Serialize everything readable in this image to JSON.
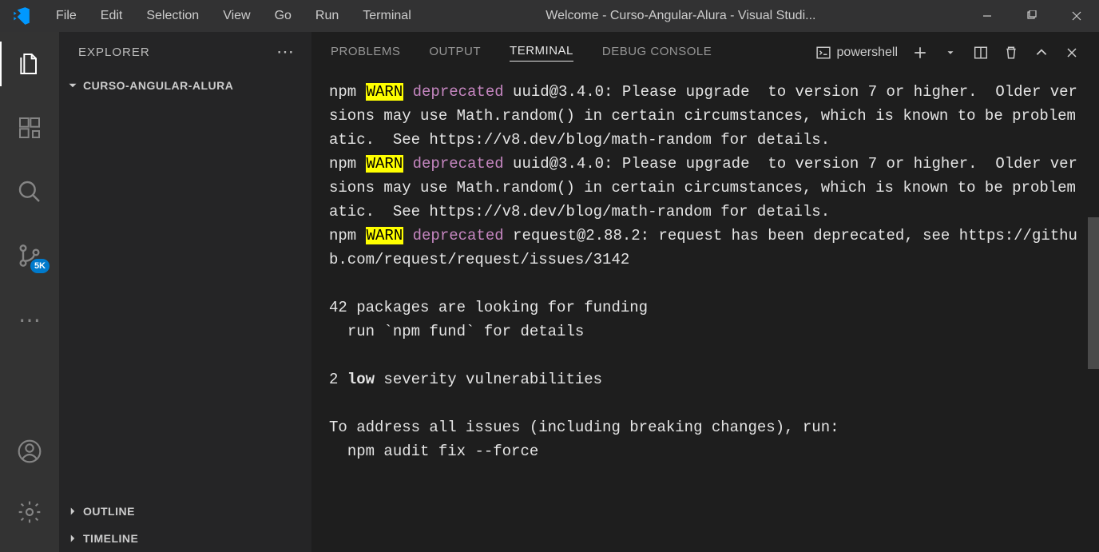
{
  "titlebar": {
    "menu": [
      "File",
      "Edit",
      "Selection",
      "View",
      "Go",
      "Run",
      "Terminal"
    ],
    "title": "Welcome - Curso-Angular-Alura - Visual Studi..."
  },
  "sidebar": {
    "header": "EXPLORER",
    "folder": "CURSO-ANGULAR-ALURA",
    "sections": [
      "OUTLINE",
      "TIMELINE"
    ]
  },
  "activitybar": {
    "badge": "5K"
  },
  "panel": {
    "tabs": [
      "PROBLEMS",
      "OUTPUT",
      "TERMINAL",
      "DEBUG CONSOLE"
    ],
    "active_tab": "TERMINAL",
    "shell": "powershell"
  },
  "terminal": {
    "warn1_prefix": "npm ",
    "warn_word": "WARN",
    "deprecated_word": " deprecated",
    "warn1_msg": " uuid@3.4.0: Please upgrade  to version 7 or higher.  Older versions may use Math.random() in certain circumstances, which is known to be problematic.  See https://v8.dev/blog/math-random for details.",
    "warn2_msg": " uuid@3.4.0: Please upgrade  to version 7 or higher.  Older versions may use Math.random() in certain circumstances, which is known to be problematic.  See https://v8.dev/blog/math-random for details.",
    "warn3_msg": " request@2.88.2: request has been deprecated, see https://github.com/request/request/issues/3142",
    "funding1": "42 packages are looking for funding",
    "funding2": "  run `npm fund` for details",
    "vuln_prefix": "2 ",
    "vuln_bold": "low",
    "vuln_suffix": " severity vulnerabilities",
    "address1": "To address all issues (including breaking changes), run:",
    "address2": "  npm audit fix --force"
  }
}
